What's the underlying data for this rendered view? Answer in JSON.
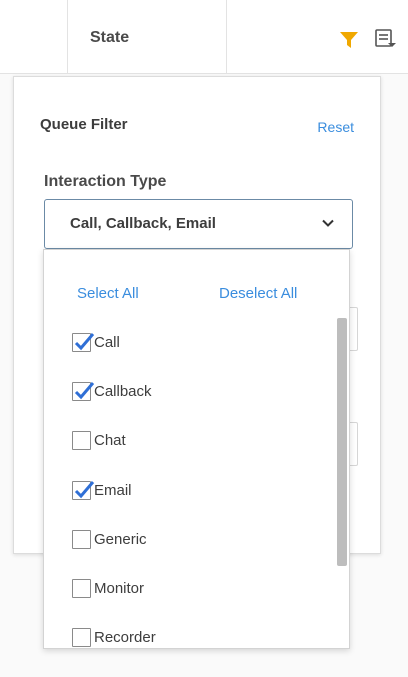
{
  "header": {
    "state_label": "State",
    "filter_icon": "funnel-icon",
    "columns_icon": "column-settings-icon",
    "accent_color": "#f0a800"
  },
  "panel": {
    "title": "Queue Filter",
    "reset_label": "Reset",
    "interaction_type_label": "Interaction Type",
    "selected_value": "Call, Callback, Email",
    "link_color": "#3a8dde",
    "check_color": "#2f6fd6"
  },
  "dropdown": {
    "select_all_label": "Select All",
    "deselect_all_label": "Deselect All",
    "options": [
      {
        "label": "Call",
        "checked": true
      },
      {
        "label": "Callback",
        "checked": true
      },
      {
        "label": "Chat",
        "checked": false
      },
      {
        "label": "Email",
        "checked": true
      },
      {
        "label": "Generic",
        "checked": false
      },
      {
        "label": "Monitor",
        "checked": false
      },
      {
        "label": "Recorder",
        "checked": false
      }
    ]
  }
}
